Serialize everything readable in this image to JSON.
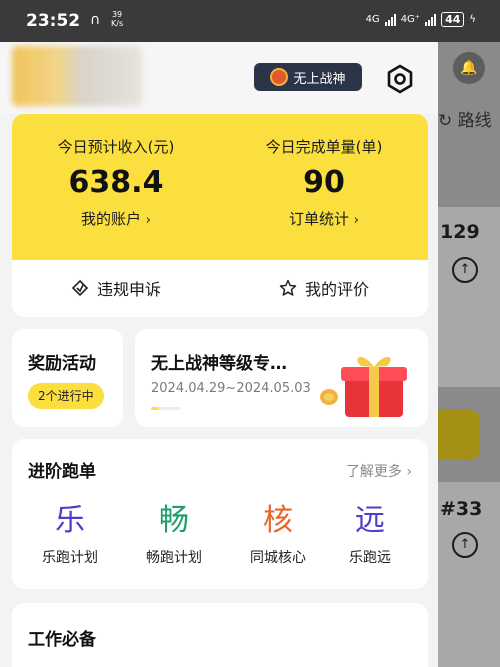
{
  "status_bar": {
    "time": "23:52",
    "speed_value": "39",
    "speed_unit": "K/s",
    "net1": "4G",
    "net2": "4G⁺",
    "battery": "44"
  },
  "background": {
    "route_label": "路线",
    "order1_num": "129",
    "order2_num": "#33"
  },
  "header": {
    "title_badge": "无上战神"
  },
  "stats": {
    "income_label": "今日预计收入(元)",
    "income_value": "638.4",
    "income_link": "我的账户",
    "orders_label": "今日完成单量(单)",
    "orders_value": "90",
    "orders_link": "订单统计"
  },
  "quick_actions": {
    "appeal": "违规申诉",
    "rating": "我的评价"
  },
  "reward": {
    "title": "奖励活动",
    "badge": "2个进行中"
  },
  "event": {
    "title": "无上战神等级专…",
    "date_range": "2024.04.29~2024.05.03"
  },
  "advanced": {
    "title": "进阶跑单",
    "more": "了解更多",
    "items": [
      {
        "glyph": "乐",
        "label": "乐跑计划",
        "color": "#4f3ec9"
      },
      {
        "glyph": "畅",
        "label": "畅跑计划",
        "color": "#1f9e6d"
      },
      {
        "glyph": "核",
        "label": "同城核心",
        "color": "#e8662a"
      },
      {
        "glyph": "远",
        "label": "乐跑远",
        "color": "#4f3ec9"
      }
    ]
  },
  "tools": {
    "title": "工作必备"
  }
}
